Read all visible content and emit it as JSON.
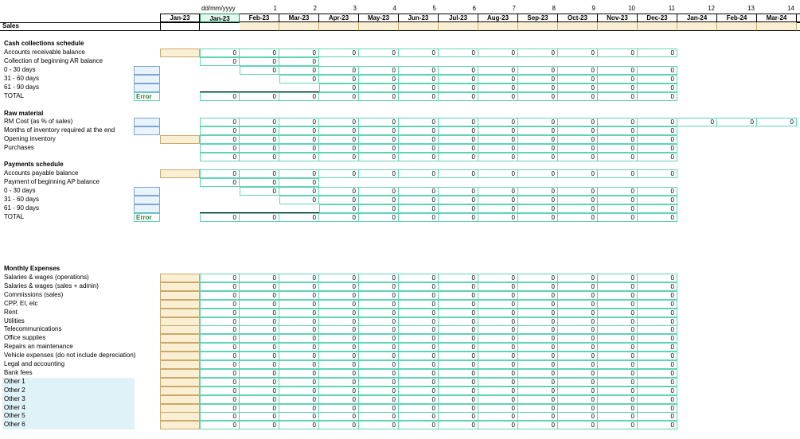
{
  "header": {
    "date_format": "dd/mm/yyyy",
    "period_numbers": [
      "1",
      "2",
      "3",
      "4",
      "5",
      "6",
      "7",
      "8",
      "9",
      "10",
      "11",
      "12",
      "13",
      "14"
    ],
    "months": [
      "Jan-23",
      "Jan-23",
      "Feb-23",
      "Mar-23",
      "Apr-23",
      "May-23",
      "Jun-23",
      "Jul-23",
      "Aug-23",
      "Sep-23",
      "Oct-23",
      "Nov-23",
      "Dec-23",
      "Jan-24",
      "Feb-24",
      "Mar-24"
    ]
  },
  "sales_label": "Sales",
  "cash": {
    "title": "Cash collections schedule",
    "ar_balance": "Accounts receivable balance",
    "collection_ar": "Collection of beginning AR balance",
    "d0_30": "0 - 30 days",
    "d31_60": "31 - 60 days",
    "d61_90": "61 - 90 days",
    "total": "TOTAL",
    "error": "Error"
  },
  "raw": {
    "title": "Raw material",
    "rm_cost": "RM Cost (as % of sales)",
    "months_inventory": "Months of inventory required at the end",
    "opening_inventory": "Opening inventory",
    "purchases": "Purchases"
  },
  "pay": {
    "title": "Payments schedule",
    "ap_balance": "Accounts payable balance",
    "payment_ap": "Payment of beginning AP balance",
    "d0_30": "0 - 30 days",
    "d31_60": "31 - 60 days",
    "d61_90": "61 - 90 days",
    "total": "TOTAL",
    "error": "Error"
  },
  "expenses": {
    "title": "Monthly Expenses",
    "items": [
      "Salaries & wages (operations)",
      "Salaries & wages (sales + admin)",
      "Commissions (sales)",
      "CPP, EI, etc",
      "Rent",
      "Utilities",
      "Telecommunications",
      "Office supplies",
      "Repairs an maintenance",
      "Vehicle expenses (do not include depreciation)",
      "Legal and accounting",
      "Bank fees",
      "Other 1",
      "Other 2",
      "Other 3",
      "Other 4",
      "Other 5",
      "Other 6"
    ]
  },
  "zero": "0",
  "colors": {
    "teal_border": "#5fd3b6",
    "input_tan": "#fbefd3",
    "input_blue": "#e9f3fb",
    "other_fill": "#dff2f7",
    "error_green": "#2f7a2f"
  }
}
